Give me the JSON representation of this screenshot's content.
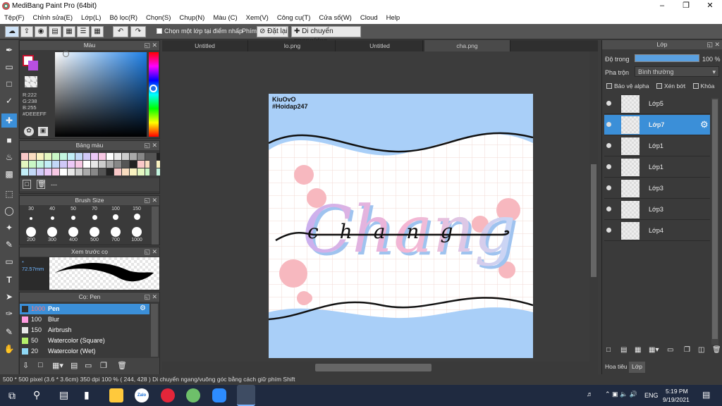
{
  "title": "MediBang Paint Pro (64bit)",
  "menu": [
    "Tệp(F)",
    "Chỉnh sửa(E)",
    "Lớp(L)",
    "Bộ lọc(R)",
    "Chọn(S)",
    "Chụp(N)",
    "Màu (C)",
    "Xem(V)",
    "Công cụ(T)",
    "Cửa sổ(W)",
    "Cloud",
    "Help"
  ],
  "toolbar": {
    "select_layer_label": "Chọn một lớp tại điểm nhấp",
    "key_label": "Phím",
    "reset_label": "Đặt lại",
    "move_label": "Di chuyển ngang/dọc"
  },
  "color_panel": {
    "title": "Màu",
    "r": "R:222",
    "g": "G:238",
    "b": "B:255",
    "hex": "#DEEEFF"
  },
  "palette_panel": {
    "title": "Bảng màu",
    "footer": "---"
  },
  "brushsize_panel": {
    "title": "Brush Size",
    "sizes_top": [
      "30",
      "40",
      "50",
      "70",
      "100",
      "150"
    ],
    "sizes_bottom": [
      "200",
      "300",
      "400",
      "500",
      "700",
      "1000"
    ]
  },
  "preview_panel": {
    "title": "Xem trước cọ",
    "size": "* 72.57mm"
  },
  "brush_panel": {
    "title": "Cọ: Pen",
    "items": [
      {
        "size": "1000",
        "name": "Pen",
        "color": "#2f2f2f"
      },
      {
        "size": "100",
        "name": "Blur",
        "color": "#ff9be0"
      },
      {
        "size": "150",
        "name": "Airbrush",
        "color": "#e8e8e8"
      },
      {
        "size": "50",
        "name": "Watercolor (Square)",
        "color": "#b4f06a"
      },
      {
        "size": "20",
        "name": "Watercolor (Wet)",
        "color": "#8fd8f5"
      }
    ]
  },
  "tabs": [
    "Untitled",
    "lo.png",
    "Untitled",
    "cha.png"
  ],
  "artwork": {
    "credit1": "KiuOvO",
    "credit2": "#Hoidap247",
    "word": "chang",
    "bg": "#a9cff8"
  },
  "layers_panel": {
    "title": "Lớp",
    "opacity_label": "Độ trong",
    "opacity_value": "100 %",
    "blend_label": "Pha trộn",
    "blend_value": "Bình thường",
    "protect_alpha": "Bảo vệ alpha",
    "clip": "Xén bớt",
    "lock": "Khóa",
    "layers": [
      "Lớp5",
      "Lớp7",
      "Lớp1",
      "Lớp1",
      "Lớp3",
      "Lớp3",
      "Lớp4"
    ],
    "tab_material": "Hoa tiêu",
    "tab_layer": "Lớp"
  },
  "status": {
    "text": "500 * 500 pixel  (3.6 * 3.6cm)  350 dpi  100 %  ( 244, 428 )  Di chuyển ngang/vuông góc bằng cách giữ phím Shift"
  },
  "taskbar": {
    "lang": "ENG",
    "time": "5:19 PM",
    "date": "9/19/2021",
    "zalo": "Zalo"
  }
}
